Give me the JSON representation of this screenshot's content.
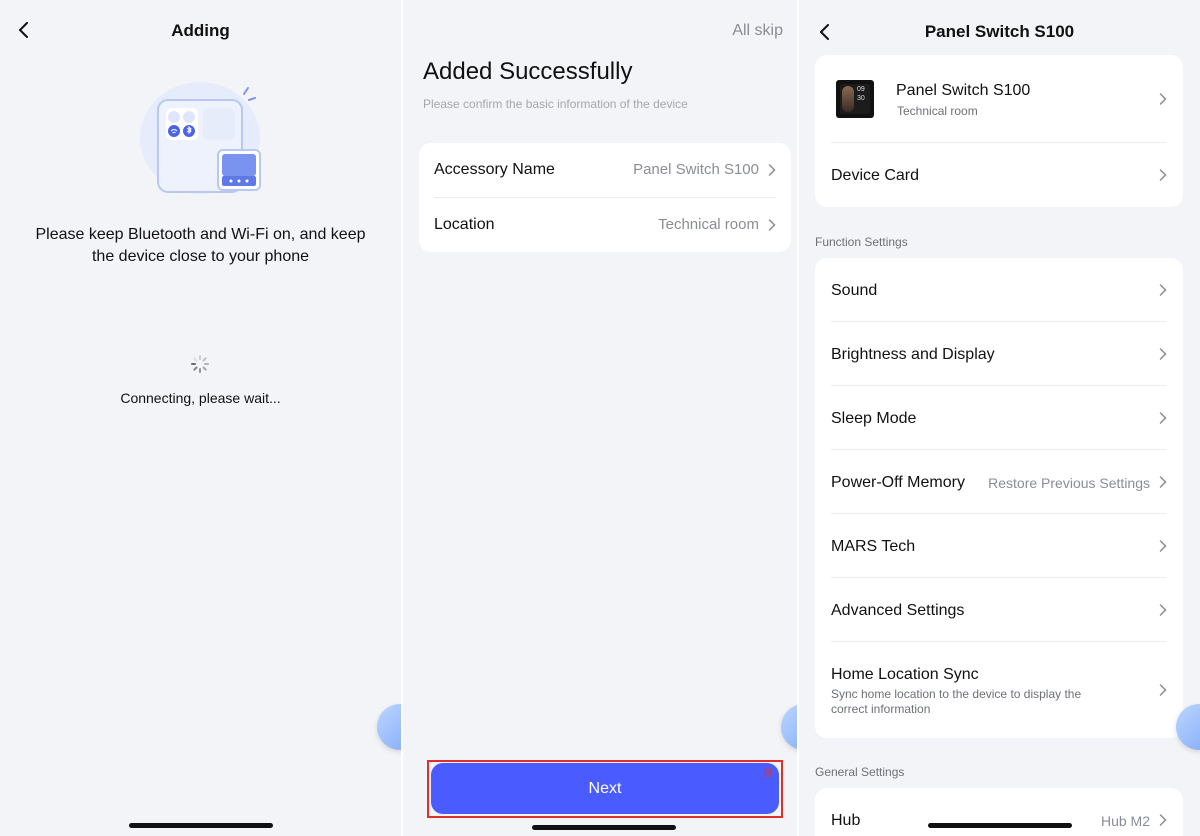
{
  "panel1": {
    "title": "Adding",
    "instruction": "Please keep Bluetooth and Wi-Fi on, and keep the device close to your phone",
    "status": "Connecting, please wait..."
  },
  "panel2": {
    "skip_label": "All skip",
    "heading": "Added Successfully",
    "subheading": "Please confirm the basic information of the device",
    "rows": [
      {
        "label": "Accessory Name",
        "value": "Panel Switch S100"
      },
      {
        "label": "Location",
        "value": "Technical room"
      }
    ],
    "next_label": "Next",
    "badge": "8"
  },
  "panel3": {
    "title": "Panel Switch S100",
    "device": {
      "name": "Panel Switch S100",
      "room": "Technical room",
      "screen_time": [
        "09",
        "30"
      ]
    },
    "device_card_label": "Device Card",
    "function_header": "Function Settings",
    "function_rows": [
      {
        "label": "Sound",
        "value": ""
      },
      {
        "label": "Brightness and Display",
        "value": ""
      },
      {
        "label": "Sleep Mode",
        "value": ""
      },
      {
        "label": "Power-Off Memory",
        "value": "Restore Previous Settings"
      },
      {
        "label": "MARS Tech",
        "value": ""
      },
      {
        "label": "Advanced Settings",
        "value": ""
      },
      {
        "label": "Home Location Sync",
        "value": "",
        "description": "Sync home location to the device to display the correct information"
      }
    ],
    "general_header": "General Settings",
    "hub": {
      "label": "Hub",
      "value": "Hub M2"
    }
  },
  "colors": {
    "accent": "#4a5cff",
    "highlight_border": "#e0302c",
    "background": "#f3f4f8"
  },
  "icons": [
    "back-chevron-icon",
    "chevron-right-icon",
    "spinner-icon",
    "assistant-float-icon"
  ]
}
